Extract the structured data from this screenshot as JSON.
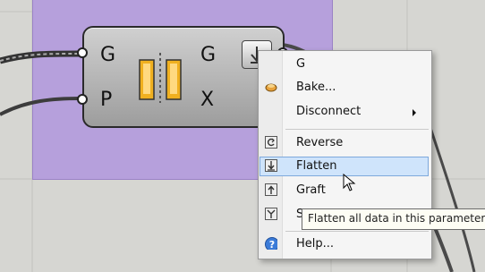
{
  "component": {
    "inputs": [
      "G",
      "P"
    ],
    "outputs": [
      "G",
      "X"
    ]
  },
  "menu": {
    "header": "G",
    "items": [
      {
        "label": "Bake...",
        "icon": "bake-icon"
      },
      {
        "label": "Disconnect",
        "icon": "",
        "submenu": true
      },
      {
        "label": "Reverse",
        "icon": "reverse-icon"
      },
      {
        "label": "Flatten",
        "icon": "flatten-icon",
        "highlighted": true
      },
      {
        "label": "Graft",
        "icon": "graft-icon"
      },
      {
        "label": "S",
        "icon": "simplify-icon"
      },
      {
        "label": "Help...",
        "icon": "help-icon"
      }
    ]
  },
  "tooltip": "Flatten all data in this parameter",
  "colors": {
    "group": "#b6a0dc",
    "highlight": "#cfe4fb",
    "wire": "#4a4a4a"
  }
}
